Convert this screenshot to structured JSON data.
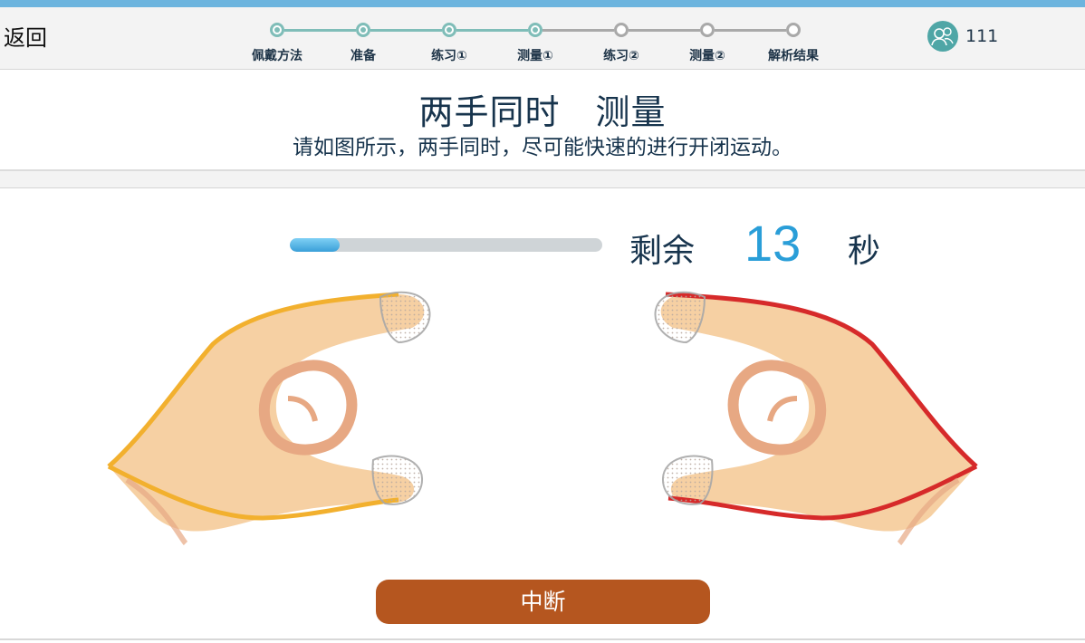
{
  "nav": {
    "back_label": "返回"
  },
  "steps": [
    {
      "label": "佩戴方法",
      "state": "done"
    },
    {
      "label": "准备",
      "state": "done"
    },
    {
      "label": "练习①",
      "state": "done"
    },
    {
      "label": "测量①",
      "state": "done"
    },
    {
      "label": "练习②",
      "state": "todo"
    },
    {
      "label": "测量②",
      "state": "todo"
    },
    {
      "label": "解析结果",
      "state": "todo"
    }
  ],
  "user": {
    "icon": "user-avatar-icon",
    "count": "111"
  },
  "page": {
    "title": "两手同时　测量",
    "subtitle": "请如图所示，两手同时，尽可能快速的进行开闭运动。"
  },
  "timer": {
    "remaining_label": "剩余",
    "remaining_value": "13",
    "unit": "秒",
    "progress_fraction": 0.16
  },
  "illustration": {
    "left_hand_icon": "left-hand-tapping-icon",
    "right_hand_icon": "right-hand-tapping-icon",
    "left_color": "#f2b02e",
    "right_color": "#d62a2a"
  },
  "actions": {
    "stop_label": "中断"
  },
  "colors": {
    "accent": "#2a9ed8",
    "button": "#b5561f",
    "step_done": "#7fbdb8",
    "step_todo": "#a9a9a9"
  }
}
